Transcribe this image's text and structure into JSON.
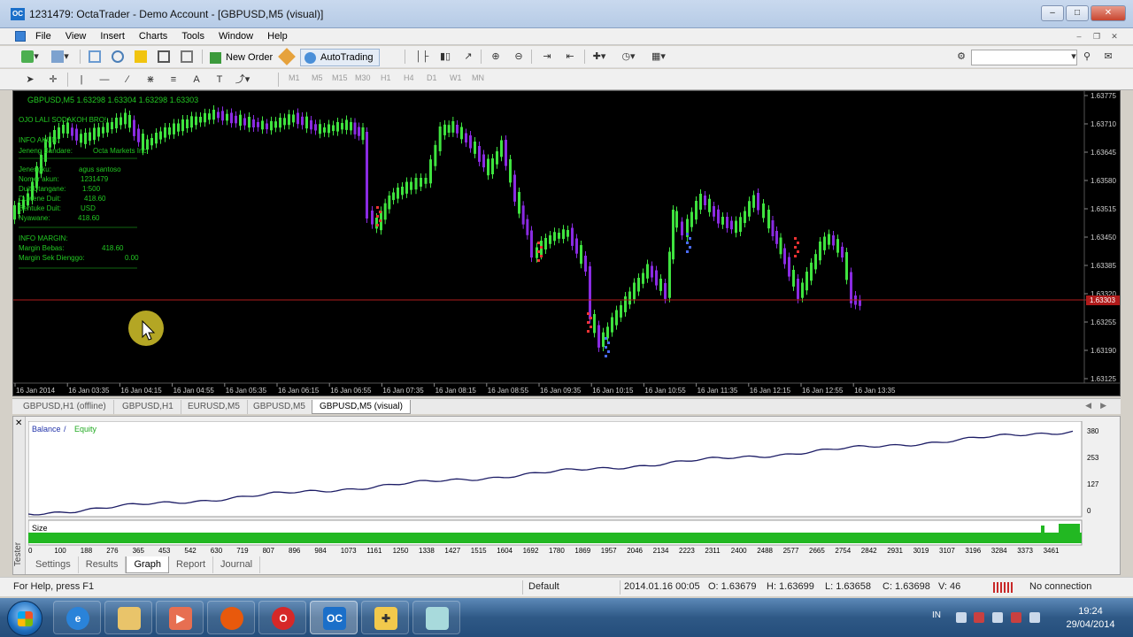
{
  "window": {
    "app_icon": "OC",
    "title": "1231479: OctaTrader - Demo Account - [GBPUSD,M5 (visual)]",
    "controls": [
      "minimize",
      "maximize",
      "close"
    ]
  },
  "menu": {
    "items": [
      "File",
      "View",
      "Insert",
      "Charts",
      "Tools",
      "Window",
      "Help"
    ]
  },
  "toolbar": {
    "new_order": "New Order",
    "autotrading": "AutoTrading",
    "timeframes": [
      "M1",
      "M5",
      "M15",
      "M30",
      "H1",
      "H4",
      "D1",
      "W1",
      "MN"
    ],
    "search_placeholder": ""
  },
  "chart": {
    "symbol_line": "GBPUSD,M5  1.63298 1.63304 1.63298 1.63303",
    "panel": {
      "header": "OJO LALI SODAKOH BRO!",
      "info_akun": "INFO AKUN:",
      "jeneng_bandar_label": "Jeneng Bandare:",
      "jeneng_bandar_value": "Octa Markets Inc",
      "rows": [
        {
          "label": "Jenengku:",
          "value": "agus santoso"
        },
        {
          "label": "Nomer akun:",
          "value": "1231479"
        },
        {
          "label": "Duit Utangane:",
          "value": "1:500"
        },
        {
          "label": "Duwene Duit:",
          "value": "418.60"
        },
        {
          "label": "Bentuke Duit:",
          "value": "USD"
        },
        {
          "label": "Nyawane:",
          "value": "418.60"
        }
      ],
      "info_margin": "INFO MARGIN:",
      "margin_rows": [
        {
          "label": "Margin Bebas:",
          "value": "418.60"
        },
        {
          "label": "Margin Sek Dienggo:",
          "value": "0.00"
        }
      ]
    },
    "price_labels": [
      "1.63775",
      "1.63710",
      "1.63645",
      "1.63580",
      "1.63515",
      "1.63450",
      "1.63385",
      "1.63320",
      "1.63255",
      "1.63190",
      "1.63125"
    ],
    "current_price": "1.63303",
    "time_labels": [
      "16 Jan 2014",
      "16 Jan 03:35",
      "16 Jan 04:15",
      "16 Jan 04:55",
      "16 Jan 05:35",
      "16 Jan 06:15",
      "16 Jan 06:55",
      "16 Jan 07:35",
      "16 Jan 08:15",
      "16 Jan 08:55",
      "16 Jan 09:35",
      "16 Jan 10:15",
      "16 Jan 10:55",
      "16 Jan 11:35",
      "16 Jan 12:15",
      "16 Jan 12:55",
      "16 Jan 13:35"
    ],
    "colors": {
      "bull": "#3fe33f",
      "bear": "#8a2be2",
      "price_line": "#b01b1b",
      "text": "#22c822"
    }
  },
  "chart_tabs": {
    "items": [
      "GBPUSD,H1 (offline)",
      "GBPUSD,H1",
      "EURUSD,M5",
      "GBPUSD,M5",
      "GBPUSD,M5 (visual)"
    ],
    "active": 4
  },
  "tester": {
    "side_label": "Tester",
    "legend_balance": "Balance",
    "legend_sep": " / ",
    "legend_equity": "Equity",
    "size_label": "Size",
    "y_ticks": [
      "380",
      "253",
      "127",
      "0"
    ],
    "x_ticks": [
      "0",
      "100",
      "188",
      "276",
      "365",
      "453",
      "542",
      "630",
      "719",
      "807",
      "896",
      "984",
      "1073",
      "1161",
      "1250",
      "1338",
      "1427",
      "1515",
      "1604",
      "1692",
      "1780",
      "1869",
      "1957",
      "2046",
      "2134",
      "2223",
      "2311",
      "2400",
      "2488",
      "2577",
      "2665",
      "2754",
      "2842",
      "2931",
      "3019",
      "3107",
      "3196",
      "3284",
      "3373",
      "3461"
    ],
    "tabs": [
      "Settings",
      "Results",
      "Graph",
      "Report",
      "Journal"
    ],
    "active_tab": 2
  },
  "status": {
    "help": "For Help, press F1",
    "profile": "Default",
    "datetime": "2014.01.16 00:05",
    "open": "O: 1.63679",
    "high": "H: 1.63699",
    "low": "L: 1.63658",
    "close": "C: 1.63698",
    "volume": "V: 46",
    "connection": "No connection"
  },
  "taskbar": {
    "apps": [
      "internet-explorer",
      "file-explorer",
      "media-player",
      "firefox",
      "opera",
      "octatrader",
      "strategy-tester",
      "notepad"
    ],
    "lang": "IN",
    "time": "19:24",
    "date": "29/04/2014"
  }
}
